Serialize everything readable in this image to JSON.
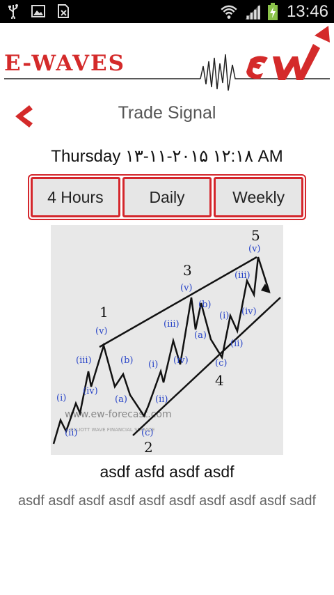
{
  "status_bar": {
    "time": "13:46",
    "left_icons": [
      "usb-icon",
      "image-icon",
      "sim-off-icon"
    ],
    "right_icons": [
      "wifi-icon",
      "signal-icon",
      "battery-charging-icon"
    ]
  },
  "header": {
    "logo_text": "E-WAVES",
    "logo_mark": "EW",
    "brand_color": "#d42a2a"
  },
  "screen": {
    "title": "Trade Signal",
    "back_icon": "chevron-left-icon",
    "datetime": "Thursday ۱۳-۱۱-۲۰۱۵ ۱۲:۱۸ AM"
  },
  "tabs": [
    {
      "label": "4 Hours"
    },
    {
      "label": "Daily"
    },
    {
      "label": "Weekly"
    }
  ],
  "chart": {
    "watermark": "www.ew-forecast.com",
    "watermark_sub": "ELLIOTT WAVE FINANCIAL SERVICE",
    "labels": [
      "1",
      "2",
      "3",
      "4",
      "5",
      "(i)",
      "(ii)",
      "(iii)",
      "(iv)",
      "(v)",
      "(a)",
      "(b)",
      "(c)"
    ]
  },
  "article": {
    "title": "asdf asfd asdf asdf",
    "body": "asdf asdf asdf asdf asdf asdf asdf asdf asdf sadf"
  }
}
